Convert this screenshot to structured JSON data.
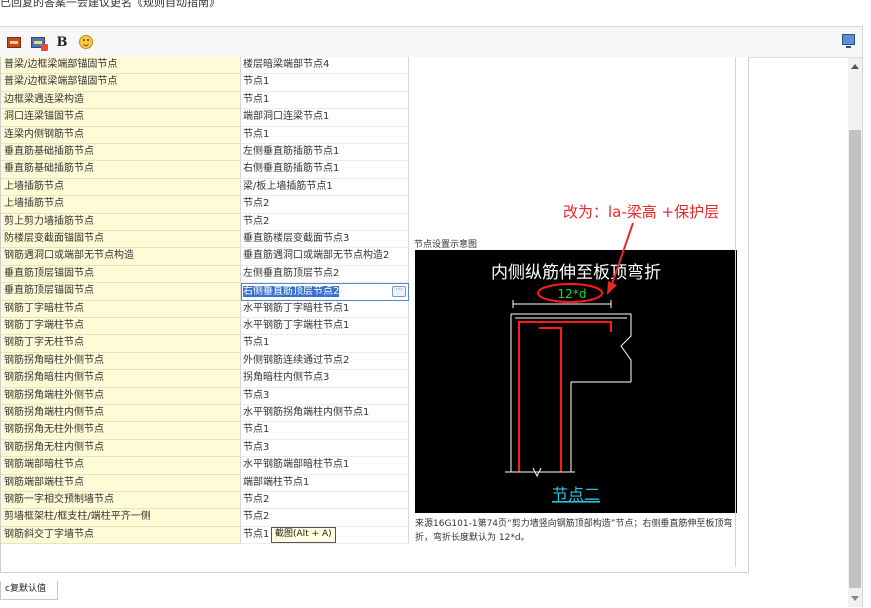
{
  "page": {
    "top_note": "已回复的答案一会建议更名《规则自动指南》",
    "restore_default_label": "c复默认值"
  },
  "toolbar": {
    "icons": [
      "insert-image-icon",
      "insert-screenshot-icon",
      "bold-icon",
      "emoji-icon",
      "fullscreen-monitor-icon"
    ],
    "bold_label": "B"
  },
  "node_settings": {
    "rows": [
      {
        "name": "普梁/边框梁端部锚固节点",
        "value": "楼层暗梁端部节点4"
      },
      {
        "name": "普梁/边框梁端部锚固节点",
        "value": "节点1"
      },
      {
        "name": "边框梁遇连梁构造",
        "value": "节点1"
      },
      {
        "name": "洞口连梁锚固节点",
        "value": "端部洞口连梁节点1"
      },
      {
        "name": "连梁内侧钢筋节点",
        "value": "节点1"
      },
      {
        "name": "垂直筋基础插筋节点",
        "value": "左侧垂直筋插筋节点1"
      },
      {
        "name": "垂直筋基础插筋节点",
        "value": "右侧垂直筋插筋节点1"
      },
      {
        "name": "上墙插筋节点",
        "value": "梁/板上墙插筋节点1"
      },
      {
        "name": "上墙插筋节点",
        "value": "节点2"
      },
      {
        "name": "剪上剪力墙插筋节点",
        "value": "节点2"
      },
      {
        "name": "防楼层变截面锚固节点",
        "value": "垂直筋楼层变截面节点3"
      },
      {
        "name": "钢筋遇洞口或端部无节点构造",
        "value": "垂直筋遇洞口或端部无节点构造2"
      },
      {
        "name": "垂直筋顶层锚固节点",
        "value": "左侧垂直筋顶层节点2"
      },
      {
        "name": "垂直筋顶层锚固节点",
        "value": "右侧垂直筋顶层节点2"
      },
      {
        "name": "钢筋丁字暗柱节点",
        "value": "水平钢筋丁字暗柱节点1"
      },
      {
        "name": "钢筋丁字端柱节点",
        "value": "水平钢筋丁字端柱节点1"
      },
      {
        "name": "钢筋丁字无柱节点",
        "value": "节点1"
      },
      {
        "name": "钢筋拐角暗柱外侧节点",
        "value": "外侧钢筋连续通过节点2"
      },
      {
        "name": "钢筋拐角暗柱内侧节点",
        "value": "拐角暗柱内侧节点3"
      },
      {
        "name": "钢筋拐角端柱外侧节点",
        "value": "节点3"
      },
      {
        "name": "钢筋拐角端柱内侧节点",
        "value": "水平钢筋拐角端柱内侧节点1"
      },
      {
        "name": "钢筋拐角无柱外侧节点",
        "value": "节点1"
      },
      {
        "name": "钢筋拐角无柱内侧节点",
        "value": "节点3"
      },
      {
        "name": "钢筋端部暗柱节点",
        "value": "水平钢筋端部暗柱节点1"
      },
      {
        "name": "钢筋端部端柱节点",
        "value": "端部端柱节点1"
      },
      {
        "name": "钢筋一字相交预制墙节点",
        "value": "节点2"
      },
      {
        "name": "剪墙框架柱/框支柱/端柱平齐一侧",
        "value": "节点2"
      },
      {
        "name": "钢筋斜交丁字墙节点",
        "value": "节点1"
      }
    ],
    "selected_index": 13,
    "tooltip": "截图(Alt + A)"
  },
  "preview": {
    "title": "节点设置示意图",
    "diagram_heading": "内侧纵筋伸至板顶弯折",
    "dimension_label": "12*d",
    "node_label": "节点二",
    "caption": "来源16G101-1第74页“剪力墙竖向钢筋顶部构造”节点；右侧垂直筋伸至板顶弯折，弯折长度默认为 12*d。",
    "annotation": "改为：la-梁高 +保护层"
  },
  "colors": {
    "name_cell_bg": "#fffbd6",
    "selection": "#3a70d2",
    "annotation": "#e6292a",
    "diagram_bg": "#000000",
    "rebar_red": "#ff1a1a",
    "dimension_green": "#22dd22",
    "label_cyan": "#27c4e6"
  }
}
